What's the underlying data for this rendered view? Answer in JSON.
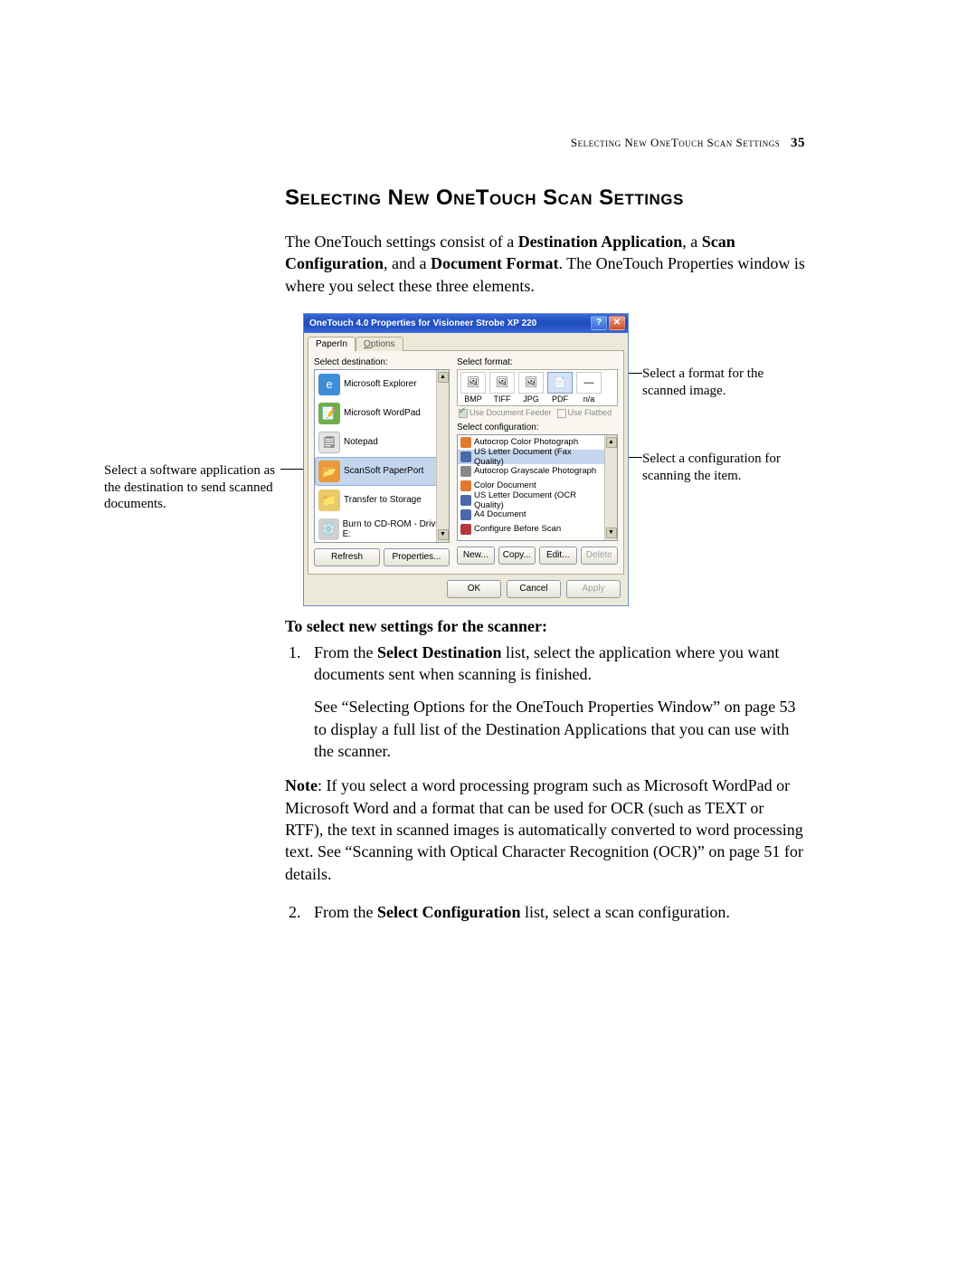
{
  "running_head": {
    "text": "Selecting New OneTouch Scan Settings",
    "page_number": "35"
  },
  "title": "Selecting New OneTouch Scan Settings",
  "intro": {
    "p1_a": "The OneTouch settings consist of a ",
    "p1_b1": "Destination Application",
    "p1_c": ", a ",
    "p1_b2": "Scan Configuration",
    "p1_d": ", and a ",
    "p1_b3": "Document Format",
    "p1_e": ". The OneTouch Properties window is where you select these three elements."
  },
  "window": {
    "title": "OneTouch 4.0 Properties for Visioneer Strobe XP 220",
    "help": "?",
    "close": "✕",
    "tabs": {
      "active": "PaperIn",
      "inactive_prefix": "O",
      "inactive_rest": "ptions"
    },
    "labels": {
      "select_destination": "Select destination:",
      "select_format": "Select format:",
      "use_feeder": "Use Document Feeder",
      "use_flatbed": "Use Flatbed",
      "select_config": "Select configuration:"
    },
    "destinations": [
      {
        "name": "Microsoft Explorer",
        "icon": "ie"
      },
      {
        "name": "Microsoft WordPad",
        "icon": "wp"
      },
      {
        "name": "Notepad",
        "icon": "np"
      },
      {
        "name": "ScanSoft PaperPort",
        "icon": "pp",
        "selected": true
      },
      {
        "name": "Transfer to Storage",
        "icon": "ts"
      },
      {
        "name": "Burn to CD-ROM - Drive E:",
        "icon": "cd"
      }
    ],
    "formats": [
      {
        "label": "BMP"
      },
      {
        "label": "TIFF"
      },
      {
        "label": "JPG"
      },
      {
        "label": "PDF",
        "selected": true
      },
      {
        "label": "n/a"
      }
    ],
    "configs": [
      {
        "name": "Autocrop Color Photograph",
        "color": "#e07a2e"
      },
      {
        "name": "US Letter Document (Fax Quality)",
        "color": "#4a6aa8",
        "selected": true
      },
      {
        "name": "Autocrop Grayscale Photograph",
        "color": "#888888"
      },
      {
        "name": "Color Document",
        "color": "#e07a2e"
      },
      {
        "name": "US Letter Document (OCR Quality)",
        "color": "#4a6aa8"
      },
      {
        "name": "A4 Document",
        "color": "#4a6aa8"
      },
      {
        "name": "Configure Before Scan",
        "color": "#b23a3a"
      }
    ],
    "buttons": {
      "refresh": "Refresh",
      "properties": "Properties...",
      "new": "New...",
      "copy": "Copy...",
      "edit": "Edit...",
      "delete": "Delete",
      "ok": "OK",
      "cancel": "Cancel",
      "apply": "Apply"
    }
  },
  "callouts": {
    "left": "Select a software application as the destination to send scanned documents.",
    "right_format": "Select a format for the scanned image.",
    "right_config": "Select a configuration for scanning the item."
  },
  "instructions": {
    "heading": "To select new settings for the scanner:",
    "step1_a": "From the ",
    "step1_b": "Select Destination",
    "step1_c": " list, select the application where you want documents sent when scanning is finished.",
    "step1_p2": "See “Selecting Options for the OneTouch Properties Window” on page 53 to display a full list of the Destination Applications that you can use with the scanner.",
    "note_label": "Note",
    "note_text": ":  If you select a word processing program such as Microsoft WordPad or Microsoft Word and a format that can be used for OCR (such as TEXT or RTF), the text in scanned images is automatically converted to word processing text. See “Scanning with Optical Character Recognition (OCR)” on page 51 for details.",
    "step2_a": "From the ",
    "step2_b": "Select Configuration",
    "step2_c": " list, select a scan configuration."
  }
}
